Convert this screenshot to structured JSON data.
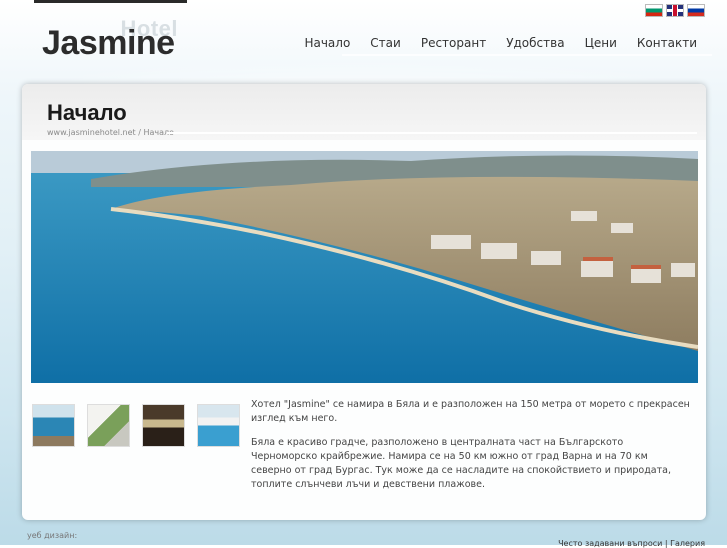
{
  "header": {
    "logo_small": "Hotel",
    "logo_main": "Jasmine",
    "nav": [
      "Начало",
      "Стаи",
      "Ресторант",
      "Удобства",
      "Цени",
      "Контакти"
    ]
  },
  "page": {
    "title": "Начало",
    "breadcrumb": "www.jasminehotel.net / Начало"
  },
  "content": {
    "paragraphs": [
      "Хотел \"Jasmine\" се намира в Бяла и е разположен на 150 метра от морето с прекрасен изглед към него.",
      "Бяла е красиво градче, разположено в централната част на Българското Черноморско крайбрежие. Намира се на 50 км южно от град Варна и на 70 км северно от град Бургас. Тук може да се насладите на спокойствието и природата, топлите слънчеви лъчи и девствени плажове."
    ]
  },
  "footer": {
    "left": "уеб дизайн:",
    "right": "Често задавани въпроси | Галерия"
  },
  "colors": {
    "accent": "#2c2c2c",
    "sea": "#1f84b6",
    "background": "#e2f0f6"
  }
}
